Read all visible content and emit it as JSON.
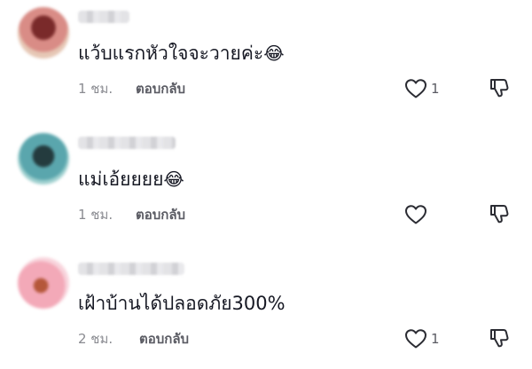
{
  "comments": [
    {
      "username": "",
      "text": "แว้บแรกหัวใจจะวายค่ะ",
      "emoji": "😂",
      "time": "1 ชม.",
      "reply_label": "ตอบกลับ",
      "likes": "1",
      "avatar_colors": [
        "#d98c86",
        "#7a2a2a",
        "#e6c7b5"
      ]
    },
    {
      "username": "",
      "text": "แม่เอ้ยยยย",
      "emoji": "😂",
      "time": "1 ชม.",
      "reply_label": "ตอบกลับ",
      "likes": "",
      "avatar_colors": [
        "#5aa6ad",
        "#243b3e",
        "#9fd0cf"
      ]
    },
    {
      "username": "",
      "text": "เฝ้าบ้านได้ปลอดภัย300%",
      "emoji": "",
      "time": "2 ชม.",
      "reply_label": "ตอบกลับ",
      "likes": "1",
      "avatar_colors": [
        "#f3a9b8",
        "#b5573a",
        "#f8d4dc"
      ]
    }
  ],
  "icons": {
    "like": "heart-outline-icon",
    "dislike": "thumbs-down-outline-icon"
  },
  "colors": {
    "text": "#161823",
    "muted": "#8a8b91",
    "secondary": "#5a5b63"
  }
}
